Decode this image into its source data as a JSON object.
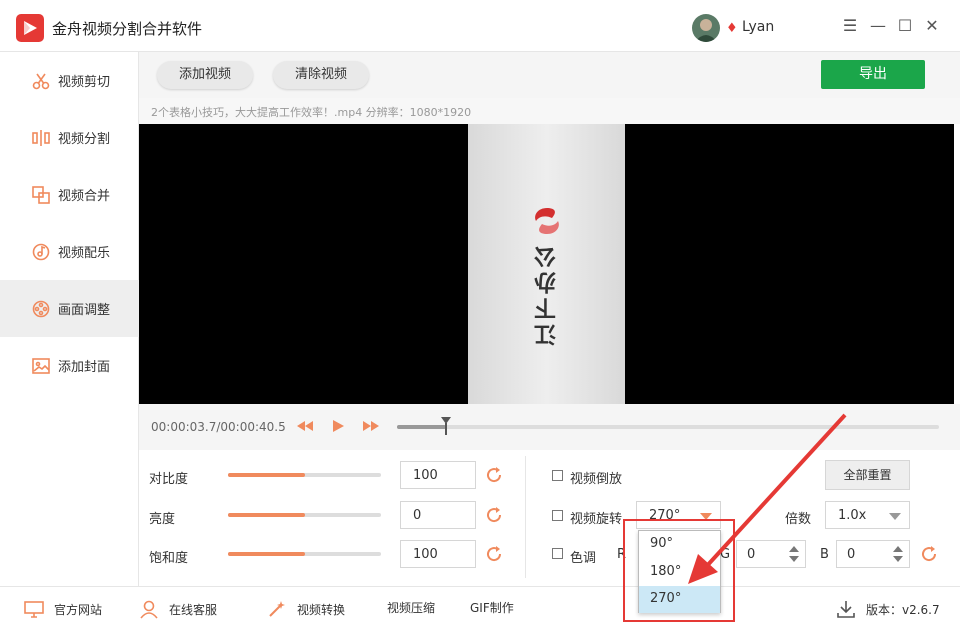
{
  "app": {
    "title": "金舟视频分割合并软件",
    "username": "Lyan",
    "vip_glyph": "♦",
    "brand_color": "#e53935"
  },
  "window_controls": {
    "menu": "☰",
    "minimize": "—",
    "maximize": "☐",
    "close": "✕"
  },
  "sidebar": {
    "items": [
      {
        "label": "视频剪切",
        "icon": "scissors-icon"
      },
      {
        "label": "视频分割",
        "icon": "split-icon"
      },
      {
        "label": "视频合并",
        "icon": "merge-icon"
      },
      {
        "label": "视频配乐",
        "icon": "music-icon"
      },
      {
        "label": "画面调整",
        "icon": "film-reel-icon",
        "active": true
      },
      {
        "label": "添加封面",
        "icon": "image-icon"
      }
    ]
  },
  "toolbar": {
    "add_label": "添加视频",
    "clear_label": "清除视频",
    "export_label": "导出",
    "export_color": "#1ba64a"
  },
  "info": {
    "text": "2个表格小技巧，大大提高工作效率！.mp4   分辨率：1080*1920"
  },
  "preview": {
    "brand_text": "江下办公"
  },
  "player": {
    "time": "00:00:03.7/00:00:40.5",
    "progress": 0.091
  },
  "adjust": {
    "contrast": {
      "label": "对比度",
      "value": "100",
      "level": 0.5
    },
    "brightness": {
      "label": "亮度",
      "value": "0",
      "level": 0.5
    },
    "saturation": {
      "label": "饱和度",
      "value": "100",
      "level": 0.5
    }
  },
  "options": {
    "reverse_label": "视频倒放",
    "rotate_label": "视频旋转",
    "rotate_value": "270°",
    "hue_label": "色调",
    "r_label": "R",
    "g_label": "G",
    "g_value": "0",
    "b_label": "B",
    "b_value": "0",
    "speed_label": "倍数",
    "speed_value": "1.0x",
    "reset_all_label": "全部重置"
  },
  "rotate_dropdown": {
    "options": [
      "90°",
      "180°",
      "270°"
    ],
    "selected": "270°"
  },
  "footer": {
    "website": "官方网站",
    "service": "在线客服",
    "convert": "视频转换",
    "compress": "视频压缩",
    "gif": "GIF制作",
    "version": "版本：v2.6.7"
  }
}
